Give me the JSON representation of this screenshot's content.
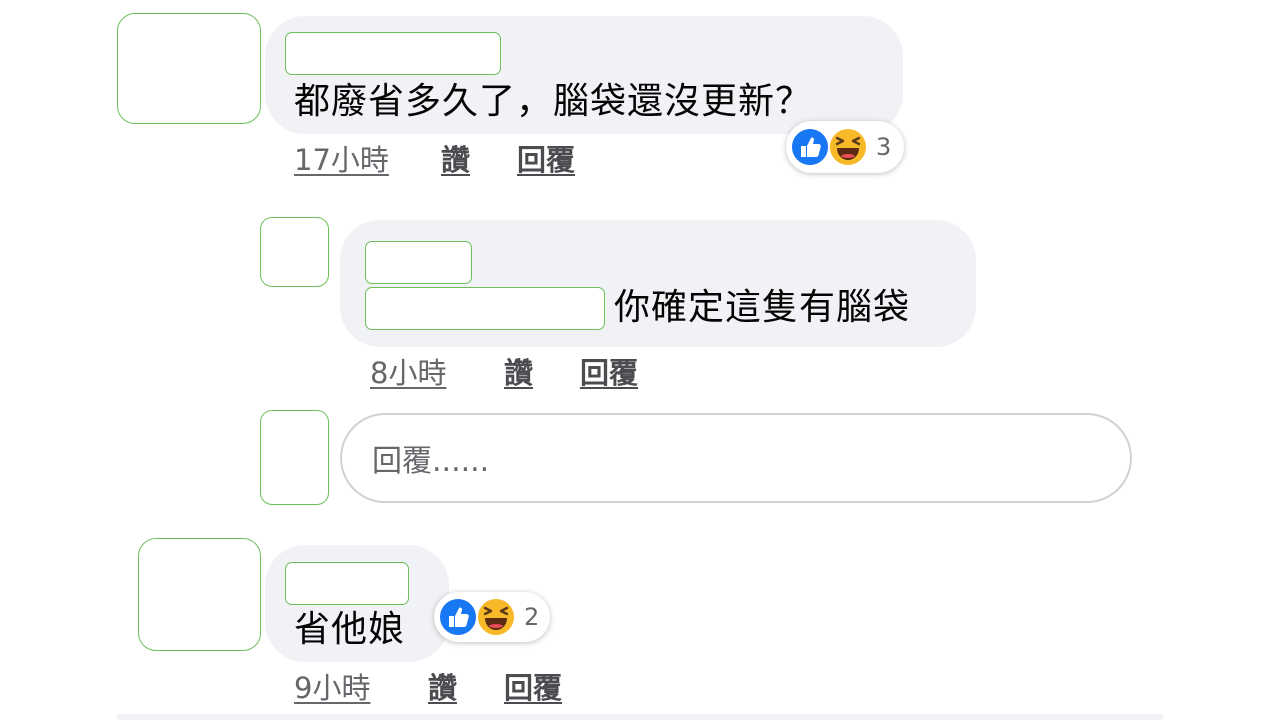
{
  "comments": [
    {
      "text": "都廢省多久了，腦袋還沒更新？",
      "time": "17小時",
      "like_label": "讚",
      "reply_label": "回覆",
      "reactions": {
        "icons": [
          "like-icon",
          "haha-icon"
        ],
        "count": "3"
      }
    },
    {
      "text": "你確定這隻有腦袋",
      "time": "8小時",
      "like_label": "讚",
      "reply_label": "回覆"
    },
    {
      "text": "省他娘",
      "time": "9小時",
      "like_label": "讚",
      "reply_label": "回覆",
      "reactions": {
        "icons": [
          "like-icon",
          "haha-icon"
        ],
        "count": "2"
      }
    }
  ],
  "reply_input": {
    "placeholder": "回覆......"
  },
  "colors": {
    "bubble": "#f0f2f5",
    "like_blue": "#1877f2",
    "haha_yellow": "#f7b928",
    "redaction_outline": "#6cbf5a"
  }
}
